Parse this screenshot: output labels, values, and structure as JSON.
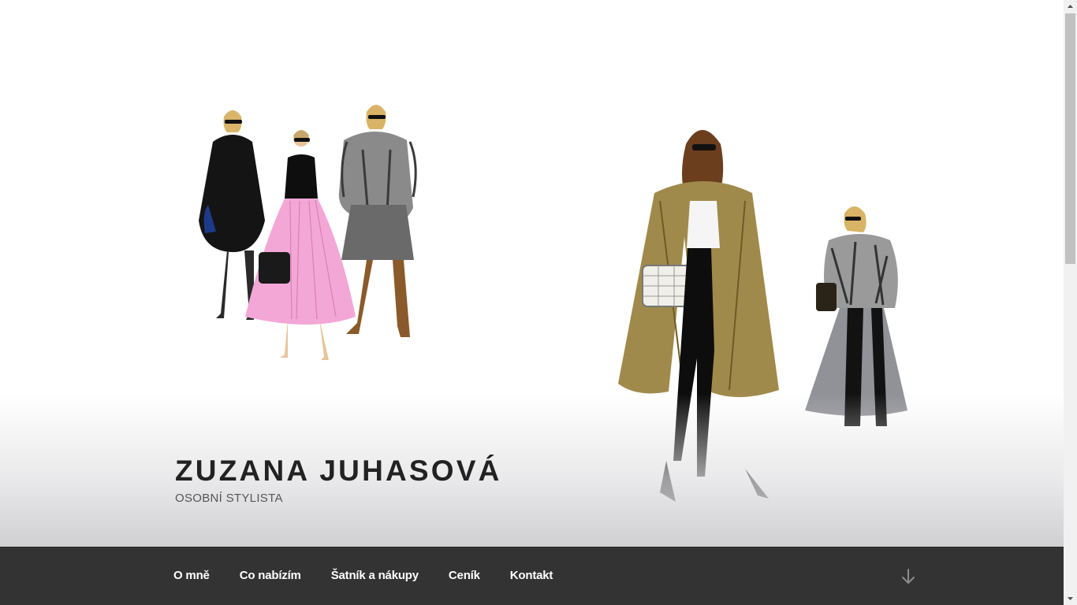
{
  "header": {
    "site_title": "ZUZANA JUHASOVÁ",
    "site_description": "OSOBNÍ STYLISTA"
  },
  "nav": {
    "items": [
      {
        "label": "O mně"
      },
      {
        "label": "Co nabízím"
      },
      {
        "label": "Šatník a nákupy"
      },
      {
        "label": "Ceník"
      },
      {
        "label": "Kontakt"
      }
    ],
    "scroll_icon": "arrow-down-icon"
  },
  "colors": {
    "nav_background": "#333333",
    "nav_text": "#ffffff",
    "title_text": "#222222"
  }
}
